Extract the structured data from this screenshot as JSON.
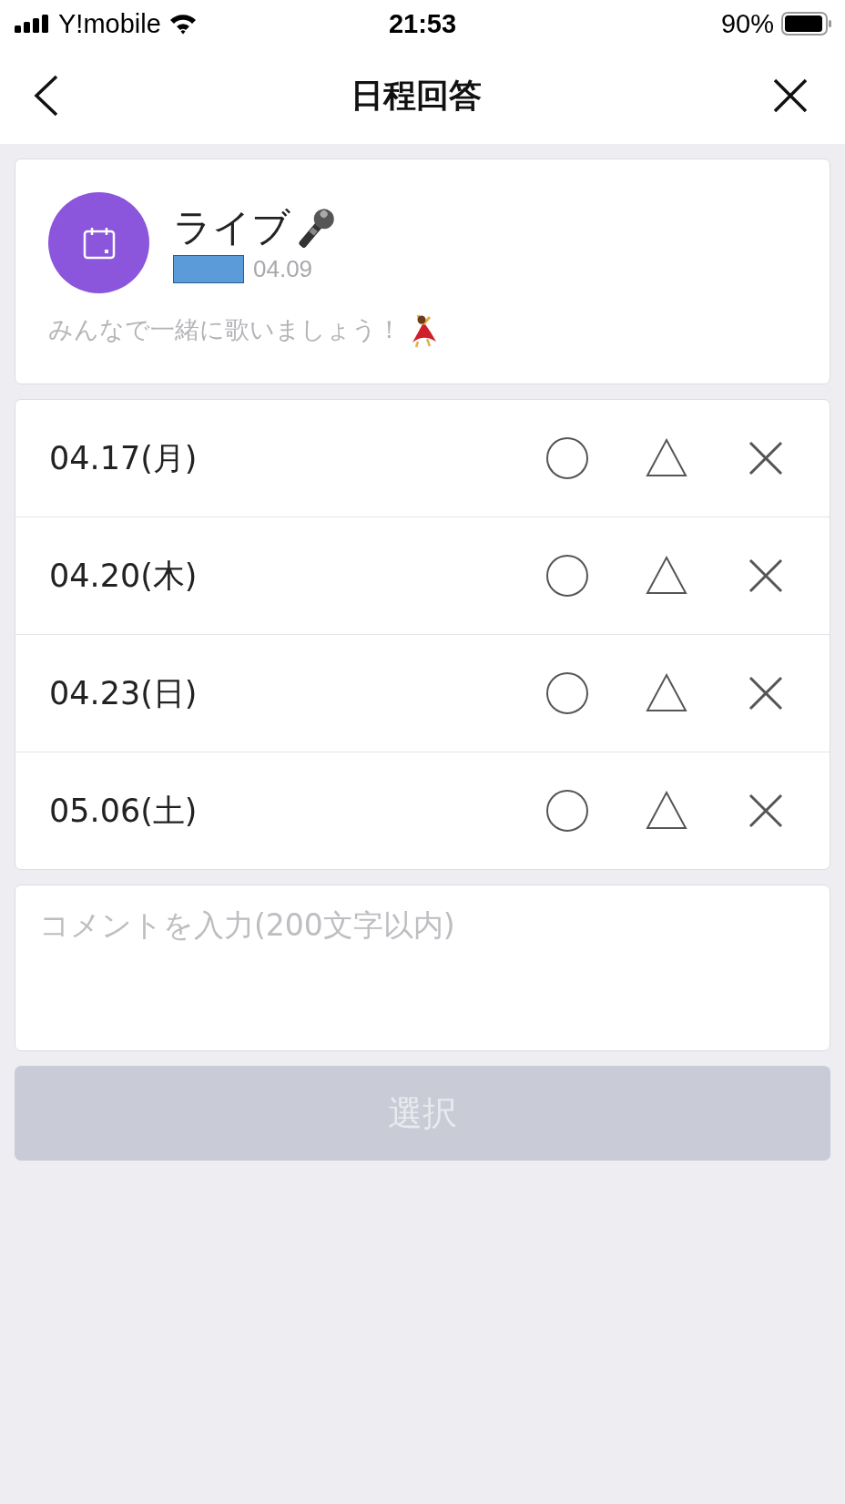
{
  "status_bar": {
    "carrier": "Y!mobile",
    "time": "21:53",
    "battery": "90%"
  },
  "nav_bar": {
    "title": "日程回答"
  },
  "event": {
    "title": "ライブ",
    "date": "04.09",
    "description": "みんなで一緒に歌いましょう！"
  },
  "dates": [
    {
      "label": "04.17(月)",
      "options": [
        {
          "kind": "circle",
          "selected": false
        },
        {
          "kind": "triangle",
          "selected": false
        },
        {
          "kind": "cross",
          "selected": false
        }
      ]
    },
    {
      "label": "04.20(木)",
      "options": [
        {
          "kind": "circle",
          "selected": false
        },
        {
          "kind": "triangle",
          "selected": false
        },
        {
          "kind": "cross",
          "selected": false
        }
      ]
    },
    {
      "label": "04.23(日)",
      "options": [
        {
          "kind": "circle",
          "selected": false
        },
        {
          "kind": "triangle",
          "selected": false
        },
        {
          "kind": "cross",
          "selected": false
        }
      ]
    },
    {
      "label": "05.06(土)",
      "options": [
        {
          "kind": "circle",
          "selected": false
        },
        {
          "kind": "triangle",
          "selected": false
        },
        {
          "kind": "cross",
          "selected": false
        }
      ]
    }
  ],
  "comment": {
    "placeholder": "コメントを入力(200文字以内)"
  },
  "submit": {
    "label": "選択",
    "disabled": true
  }
}
